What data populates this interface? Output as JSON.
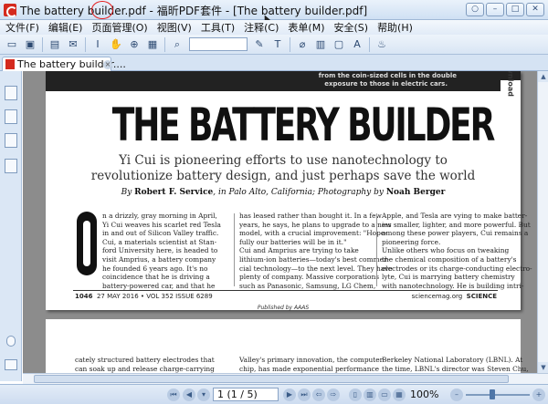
{
  "window": {
    "title": "The battery builder.pdf - 福昕PDF套件 - [The battery builder.pdf]",
    "buttons": [
      "○",
      "–",
      "□",
      "✕"
    ]
  },
  "menu": [
    "文件(F)",
    "编辑(E)",
    "页面管理(O)",
    "视图(V)",
    "工具(T)",
    "注释(C)",
    "表单(M)",
    "安全(S)",
    "帮助(H)"
  ],
  "toolbar": {
    "icons": [
      "open-icon",
      "save-icon",
      "print-icon",
      "email-icon",
      "select-icon",
      "hand-icon",
      "zoom-icon",
      "snapshot-icon",
      "find-icon",
      "search-box",
      "edit-icon",
      "typewriter-icon",
      "attach-icon",
      "stamp-icon",
      "note-icon",
      "text-icon",
      "fire-icon"
    ]
  },
  "tab": {
    "label": "The battery builder....",
    "close": "×"
  },
  "pdf": {
    "photo_caption_1": "from the coin-sized cells in the double",
    "photo_caption_2": "exposure to those in electric cars.",
    "side_label": "Download",
    "headline": "THE BATTERY BUILDER",
    "subhead_1": "Yi Cui is pioneering efforts to use nanotechnology to",
    "subhead_2": "revolutionize battery design, and just perhaps save the world",
    "byline_by": "By",
    "byline_author": "Robert F. Service",
    "byline_mid": ", in Palo Alto, California; Photography by",
    "byline_photographer": "Noah Berger",
    "col1": [
      "n a drizzly, gray morning in April,",
      "Yi Cui weaves his scarlet red Tesla",
      "in and out of Silicon Valley traffic.",
      "Cui, a materials scientist at Stan-",
      "ford University here, is headed to",
      "visit Amprius, a battery company",
      "he founded 6 years ago. It's no",
      "coincidence that he is driving a",
      "battery-powered car, and that he"
    ],
    "col2": [
      "has leased rather than bought it. In a few",
      "years, he says, he plans to upgrade to a new",
      "model, with a crucial improvement: \"Hope-",
      "fully our batteries will be in it.\"",
      "   Cui and Amprius are trying to take",
      "lithium-ion batteries—today's best commer-",
      "cial technology—to the next level. They have",
      "plenty of company. Massive corporations",
      "such as Panasonic, Samsung, LG Chem,"
    ],
    "col3": [
      "Apple, and Tesla are vying to make batter-",
      "ies smaller, lighter, and more powerful. But",
      "among these power players, Cui remains a",
      "pioneering force.",
      "   Unlike others who focus on tweaking",
      "the chemical composition of a battery's",
      "electrodes or its charge-conducting electro-",
      "lyte, Cui is marrying battery chemistry",
      "with nanotechnology. He is building intri-"
    ],
    "folio_page": "1046",
    "folio_date": "27 MAY 2016 • VOL 352 ISSUE 6289",
    "folio_site": "sciencemag.org",
    "folio_journal": "SCIENCE",
    "published": "Published by AAAS",
    "page2_col1": [
      "cately structured battery electrodes that",
      "can soak up and release charge-carrying"
    ],
    "page2_col2": [
      "Valley's primary innovation, the computer",
      "chip, has made exponential performance"
    ],
    "page2_col3": [
      "Berkeley National Laboratory (LBNL). At",
      "the time, LBNL's director was Steven Chu,"
    ]
  },
  "status": {
    "page_field": "1 (1 / 5)",
    "zoom": "100%"
  }
}
